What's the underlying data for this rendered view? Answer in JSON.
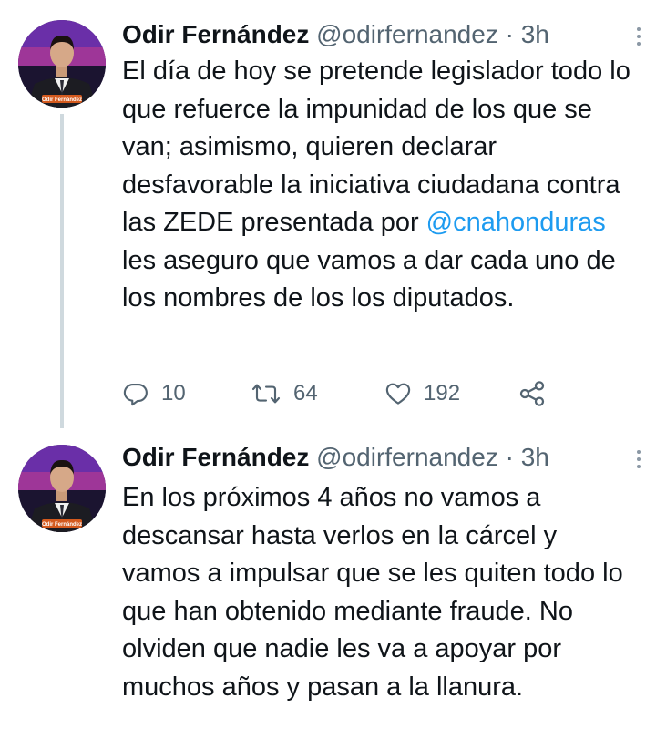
{
  "tweets": [
    {
      "author_name": "Odir Fernández",
      "handle": "@odirfernandez",
      "separator": "·",
      "time": "3h",
      "avatar_label": "Odir Fernández",
      "text_before_mention": "El día de hoy se pretende legislador todo lo que refuerce la impunidad de los que se van; asimismo, quieren declarar desfavorable la iniciativa ciudadana contra las ZEDE presentada por ",
      "mention": "@cnahonduras",
      "text_after_mention": " les aseguro que vamos a dar cada uno de los nombres de los los diputados.",
      "replies": "10",
      "retweets": "64",
      "likes": "192"
    },
    {
      "author_name": "Odir Fernández",
      "handle": "@odirfernandez",
      "separator": "·",
      "time": "3h",
      "avatar_label": "Odir Fernández",
      "text": "En los próximos 4 años no vamos a descansar hasta verlos en la cárcel y vamos a impulsar que se les quiten todo lo que han obtenido mediante fraude. No olviden que nadie les va a apoyar por muchos años y pasan a la llanura."
    }
  ],
  "icons": {
    "reply": "reply-icon",
    "retweet": "retweet-icon",
    "like": "heart-icon",
    "share": "share-icon",
    "more": "more-icon"
  },
  "colors": {
    "text": "#0f1419",
    "secondary": "#536471",
    "link": "#1d9bf0",
    "thread_line": "#cfd9de"
  }
}
